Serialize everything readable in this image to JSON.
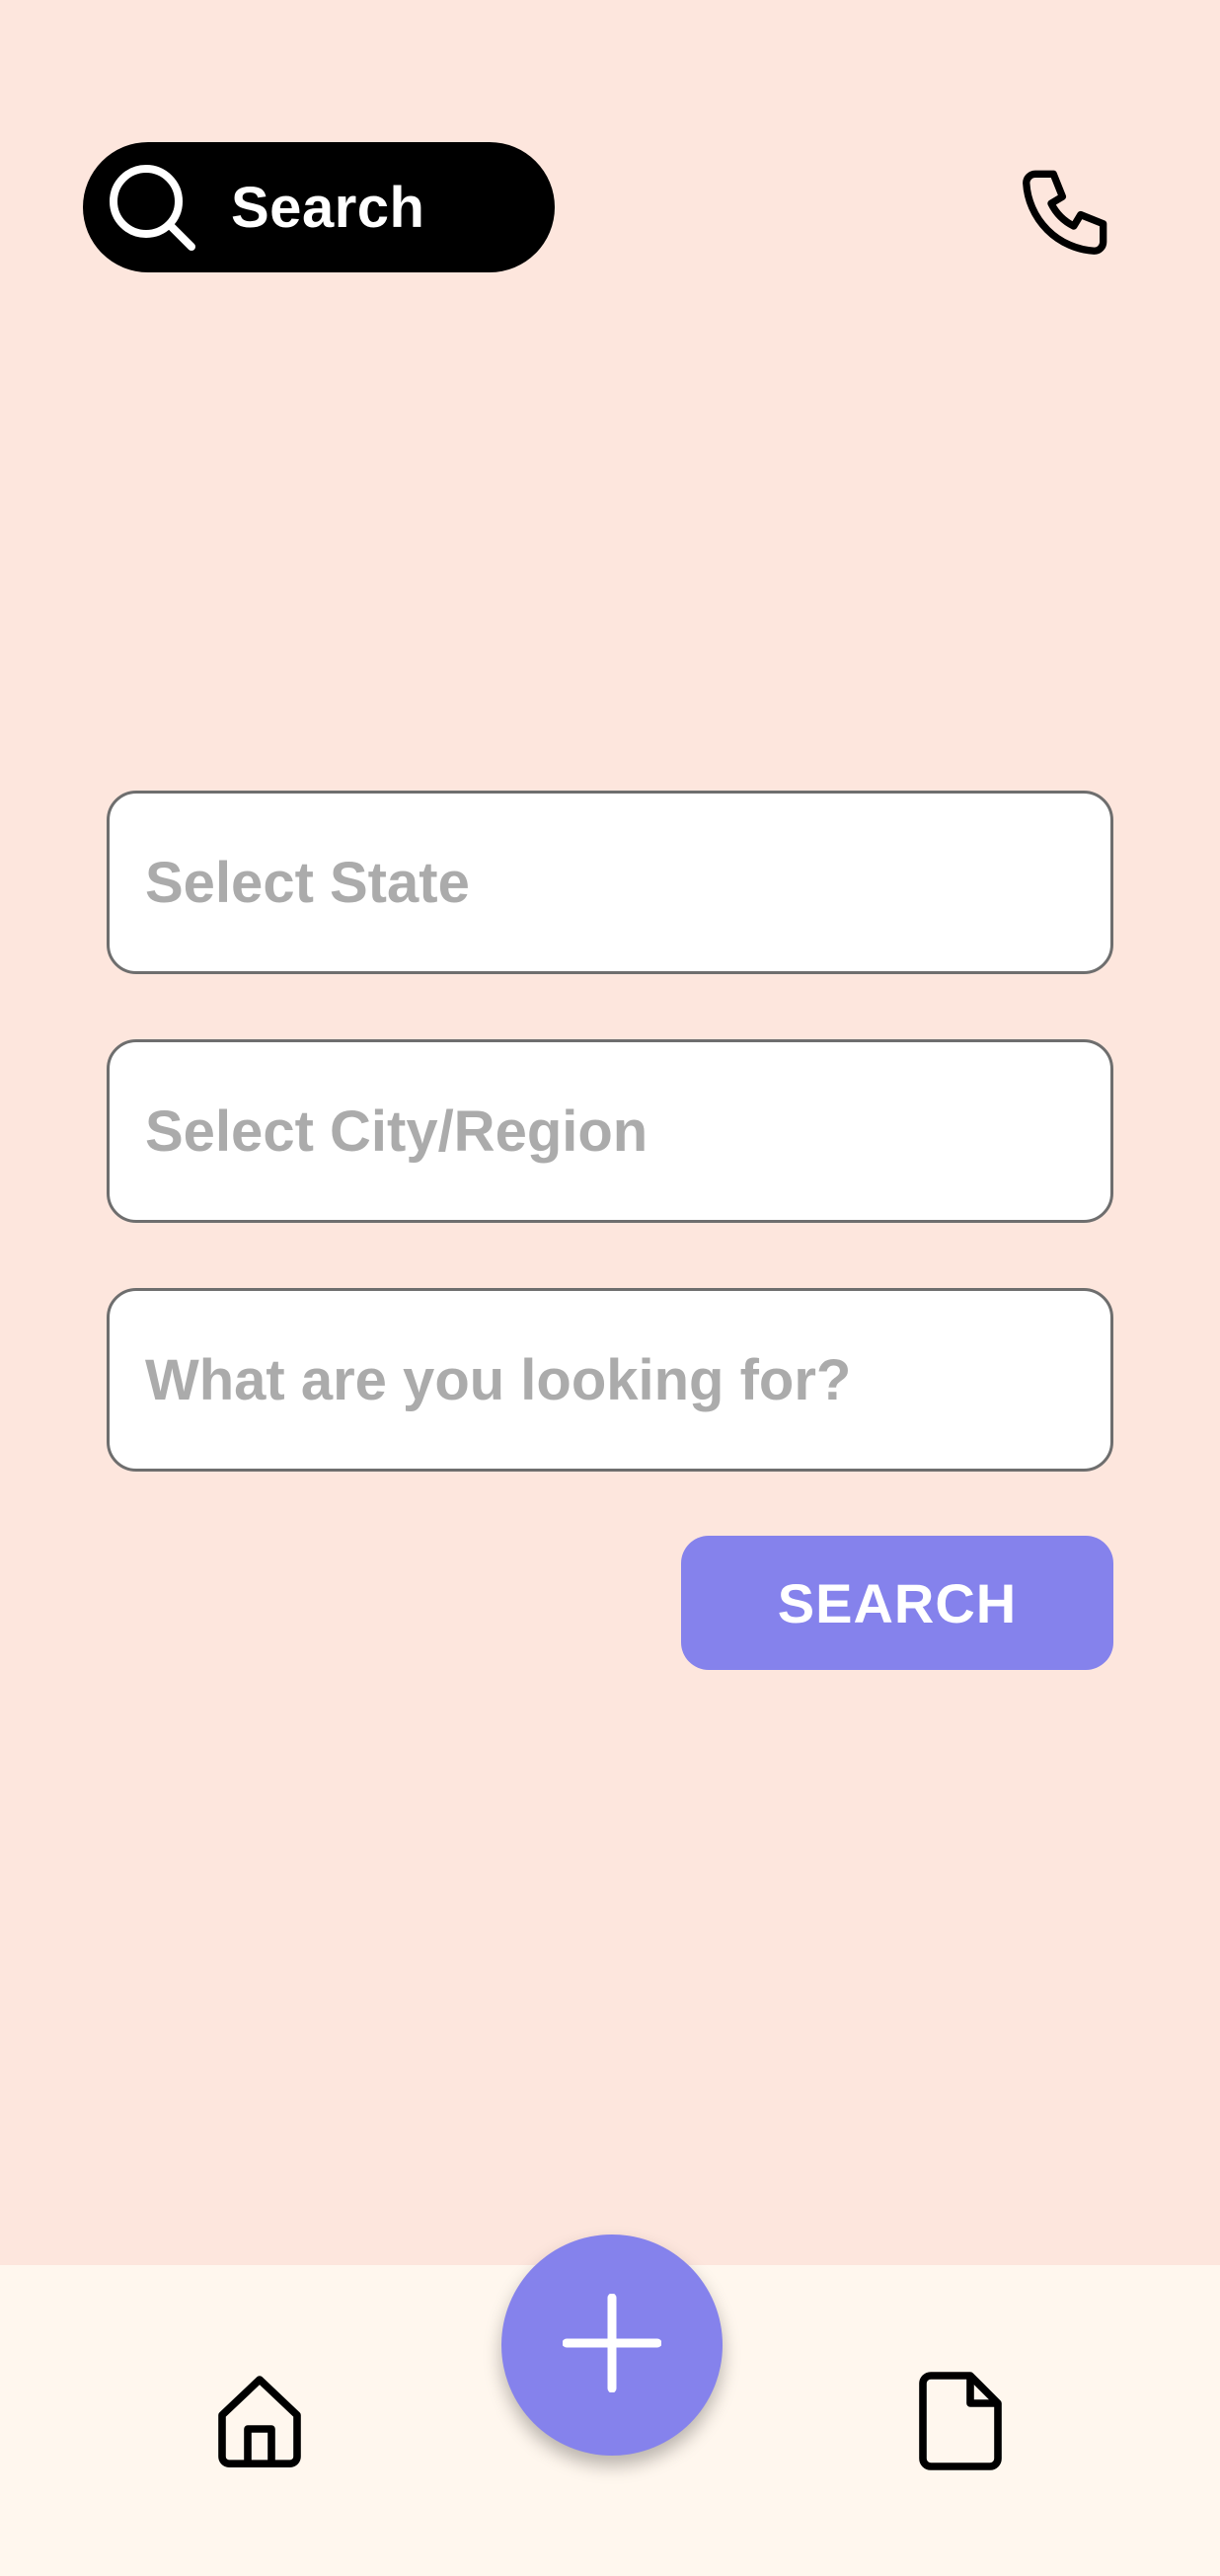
{
  "header": {
    "search_label": "Search"
  },
  "form": {
    "state_placeholder": "Select State",
    "city_placeholder": "Select City/Region",
    "query_placeholder": "What are you looking for?",
    "submit_label": "SEARCH"
  },
  "icons": {
    "search": "search-icon",
    "phone": "phone-icon",
    "home": "home-icon",
    "add": "plus-icon",
    "document": "document-icon"
  },
  "colors": {
    "background": "#FDE6DD",
    "bottom_bar": "#FFF7EE",
    "accent": "#8582EC",
    "pill": "#000000",
    "placeholder": "#ABABAB"
  }
}
